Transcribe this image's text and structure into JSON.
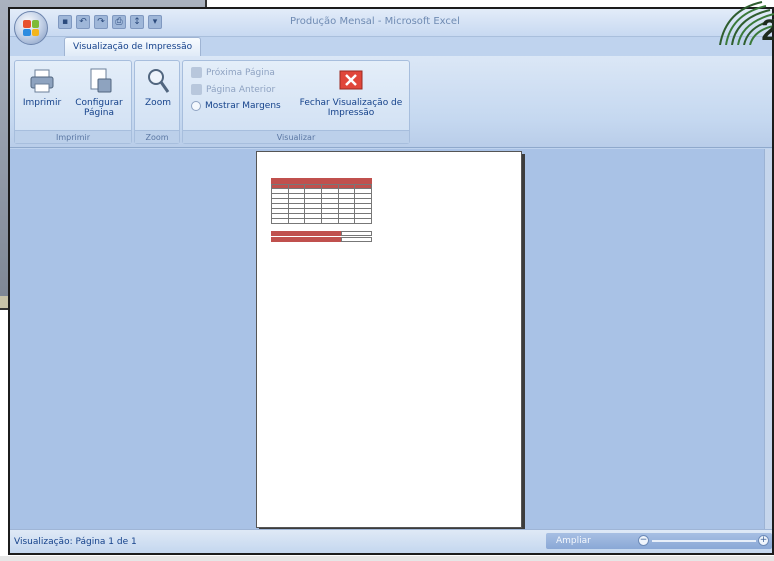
{
  "window": {
    "title": "Produção Mensal - Microsoft Excel"
  },
  "quick_access": [
    "save-icon",
    "undo-icon",
    "redo-icon",
    "print-icon",
    "sort-icon",
    "dropdown-icon"
  ],
  "tabs": [
    {
      "label": "Visualização de Impressão",
      "active": true
    }
  ],
  "ribbon": {
    "groups": {
      "imprimir": {
        "label": "Imprimir",
        "buttons": {
          "imprimir": "Imprimir",
          "configurar": "Configurar Página"
        }
      },
      "zoom": {
        "label": "Zoom",
        "buttons": {
          "zoom": "Zoom"
        }
      },
      "visualizar": {
        "label": "Visualizar",
        "proxima": "Próxima Página",
        "anterior": "Página Anterior",
        "margens": "Mostrar Margens",
        "fechar": "Fechar Visualização de Impressão"
      }
    }
  },
  "status": {
    "text": "Visualização: Página 1 de 1",
    "zoom_label": "Ampliar"
  },
  "logo": {
    "number": "2"
  },
  "colors": {
    "accent": "#c0504d",
    "ribbon": "#c5d8f0",
    "workspace": "#a9c2e6"
  }
}
